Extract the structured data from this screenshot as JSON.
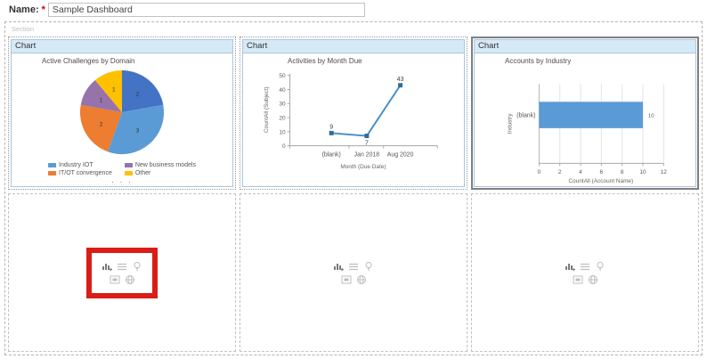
{
  "form": {
    "name_label": "Name:",
    "required_marker": "*",
    "name_value": "Sample Dashboard"
  },
  "section_label": "Section",
  "panel_header": "Chart",
  "colors": {
    "header_bg": "#d6e9f7",
    "panel_border": "#a9c7e1",
    "highlight": "#da1d17"
  },
  "chart_data": [
    {
      "type": "pie",
      "title": "Active Challenges by Domain",
      "values": [
        2,
        3,
        2,
        1,
        1
      ],
      "colors": [
        "#4472c4",
        "#5b9bd5",
        "#ed7d31",
        "#9673ab",
        "#ffc000"
      ],
      "legend": [
        {
          "label": "Industry IOT",
          "color": "#5b9bd5"
        },
        {
          "label": "New business models",
          "color": "#9673ab"
        },
        {
          "label": "IT/OT convergence",
          "color": "#ed7d31"
        },
        {
          "label": "Other",
          "color": "#ffc000"
        }
      ],
      "legend_overflow": "· · ·"
    },
    {
      "type": "line",
      "title": "Activities by Month Due",
      "categories": [
        "(blank)",
        "Jan 2018",
        "Aug 2020"
      ],
      "values": [
        9,
        7,
        43
      ],
      "label_side": [
        "above",
        "below",
        "above"
      ],
      "ylabel": "CountAll (Subject)",
      "xlabel": "Month (Due Date)",
      "ylim": [
        0,
        50
      ],
      "yticks": [
        0,
        10,
        20,
        30,
        40,
        50
      ],
      "line_color": "#4a8fc7",
      "marker_color": "#2c6e9c"
    },
    {
      "type": "bar-horizontal",
      "title": "Accounts by Industry",
      "categories": [
        "(blank)"
      ],
      "values": [
        10
      ],
      "ylabel": "Industry",
      "xlabel": "CountAll (Account Name)",
      "xlim": [
        0,
        12
      ],
      "xticks": [
        0,
        2,
        4,
        6,
        8,
        10,
        12
      ],
      "bar_color": "#5b9bd5"
    }
  ],
  "empty_panel": {
    "icon_rows": [
      [
        "insert-chart",
        "insert-list",
        "insert-assistant"
      ],
      [
        "insert-iframe",
        "insert-webresource"
      ]
    ]
  }
}
